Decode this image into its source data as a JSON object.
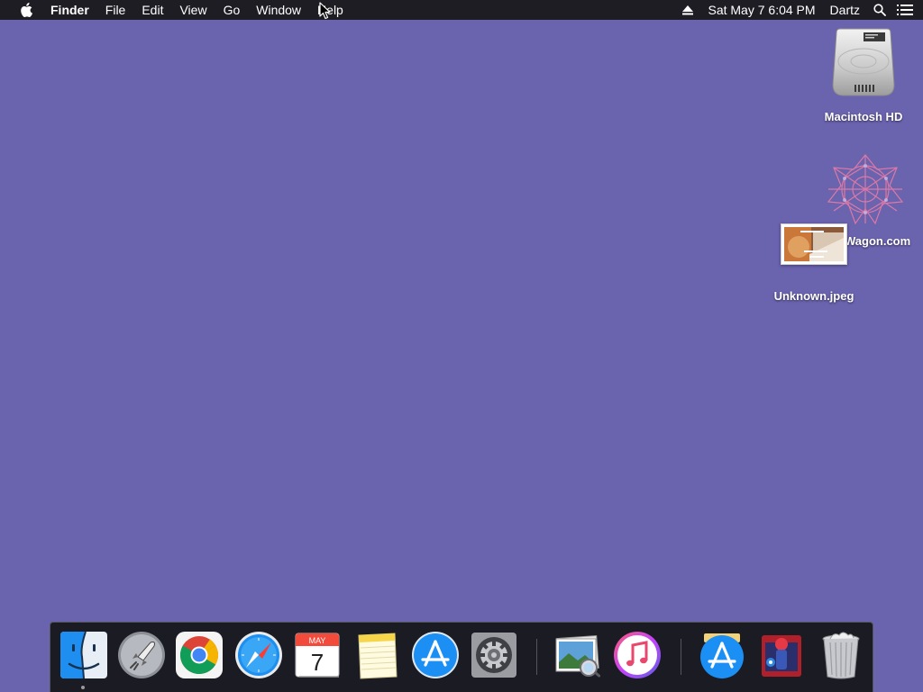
{
  "menubar": {
    "app_name": "Finder",
    "menus": [
      "File",
      "Edit",
      "View",
      "Go",
      "Window",
      "Help"
    ],
    "datetime": "Sat May 7  6:04 PM",
    "user": "Dartz"
  },
  "desktop": {
    "icons": [
      {
        "label": "Macintosh HD"
      },
      {
        "label": "Wagon.com"
      },
      {
        "label": "Unknown.jpeg"
      }
    ]
  },
  "dock": {
    "calendar_month": "MAY",
    "calendar_day": "7",
    "icon_names": [
      "finder-icon",
      "launchpad-icon",
      "chrome-icon",
      "safari-icon",
      "calendar-icon",
      "notes-icon",
      "app-store-icon",
      "system-preferences-icon",
      "preview-icon",
      "itunes-icon",
      "app-store-download-icon",
      "photo-booth-icon",
      "trash-icon"
    ]
  },
  "colors": {
    "desktop": "#6a63ae",
    "menubar": "#1f1d24",
    "dock": "#18181e"
  }
}
